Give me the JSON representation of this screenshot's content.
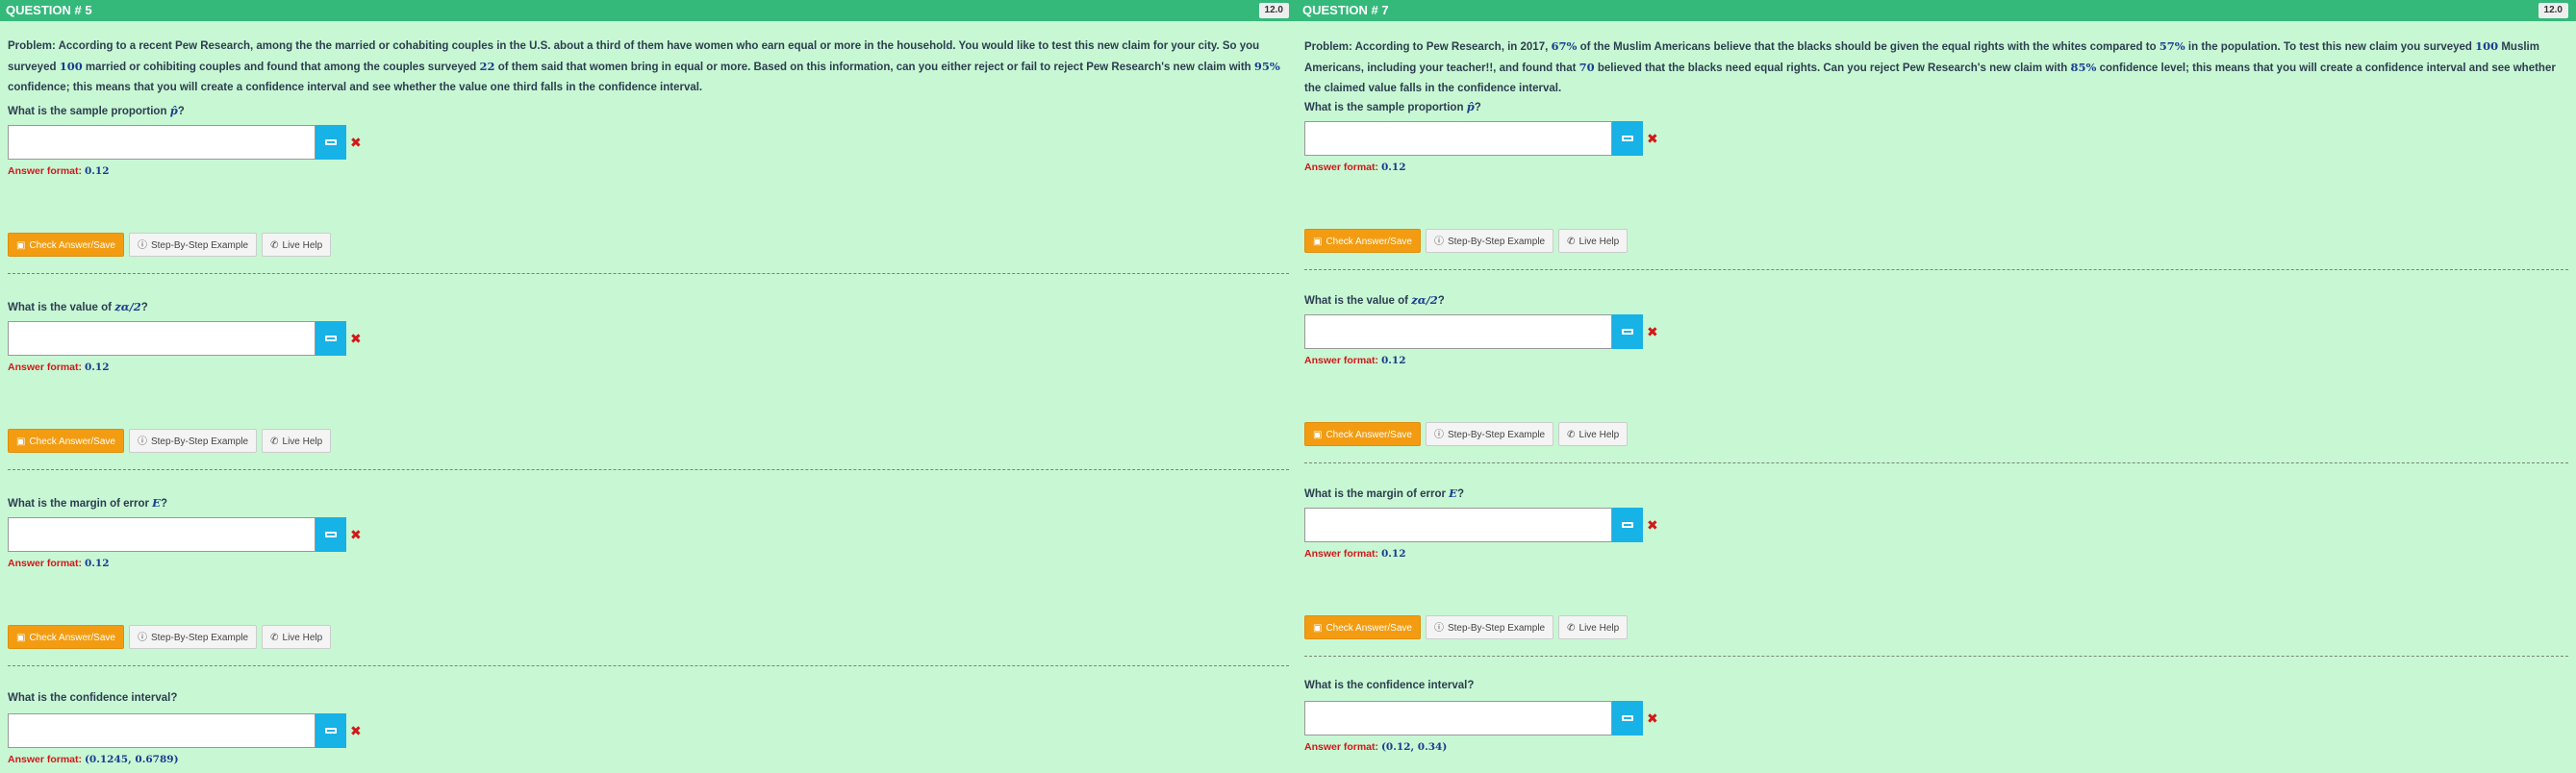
{
  "left": {
    "header": "QUESTION # 5",
    "points": "12.0",
    "problem_parts": [
      "Problem: According to a recent Pew Research, among the the married or cohabiting couples in the U.S. about a third of them have women who earn equal or more in the household. You would like to test this new claim for your city. So you surveyed ",
      "100",
      " married or cohibiting couples and found that among the couples surveyed ",
      "22",
      " of them said that women bring in equal or more. Based on this information, can you either reject or fail to reject Pew Research's new claim with ",
      "95%",
      " confidence; this means that you will create a confidence interval and see whether the value one third falls in the confidence interval."
    ],
    "questions": [
      {
        "label": "What is the sample proportion ",
        "math": "p̂",
        "suffix": "?",
        "format_label": "Answer format:",
        "format_value": "0.12"
      },
      {
        "label": "What is the value of ",
        "math": "zα/2",
        "suffix": "?",
        "format_label": "Answer format:",
        "format_value": "0.12"
      },
      {
        "label": "What is the margin of error ",
        "math": "E",
        "suffix": "?",
        "format_label": "Answer format:",
        "format_value": "0.12"
      },
      {
        "label": "What is the confidence interval?",
        "math": "",
        "suffix": "",
        "format_label": "Answer format:",
        "format_value": "(0.1245, 0.6789)"
      }
    ]
  },
  "right": {
    "header": "QUESTION # 7",
    "points": "12.0",
    "problem_parts": [
      "Problem: According to Pew Research, in 2017, ",
      "67%",
      " of the Muslim Americans believe that the blacks should be given the equal rights with the whites compared to ",
      "57%",
      " in the population. To test this new claim you surveyed ",
      "100",
      " Muslim Americans, including your teacher!!, and found that ",
      "70",
      " believed that the blacks need equal rights. Can you reject Pew Research's new claim with ",
      "85%",
      " confidence level; this means that you will create a confidence interval and see whether the claimed value falls in the confidence interval."
    ],
    "questions": [
      {
        "label": "What is the sample proportion ",
        "math": "p̂",
        "suffix": "?",
        "format_label": "Answer format:",
        "format_value": "0.12"
      },
      {
        "label": "What is the value of ",
        "math": "zα/2",
        "suffix": "?",
        "format_label": "Answer format:",
        "format_value": "0.12"
      },
      {
        "label": "What is the margin of error ",
        "math": "E",
        "suffix": "?",
        "format_label": "Answer format:",
        "format_value": "0.12"
      },
      {
        "label": "What is the confidence interval?",
        "math": "",
        "suffix": "",
        "format_label": "Answer format:",
        "format_value": "(0.12, 0.34)"
      }
    ]
  },
  "buttons": {
    "check": "Check Answer/Save",
    "example": "Step-By-Step Example",
    "help": "Live Help"
  },
  "colors": {
    "header": "#34b97b",
    "background": "#c8f7d4",
    "check_button": "#f39c12",
    "keyboard_button": "#17b2e6",
    "error": "#d21818",
    "math": "#1a3d8f"
  }
}
